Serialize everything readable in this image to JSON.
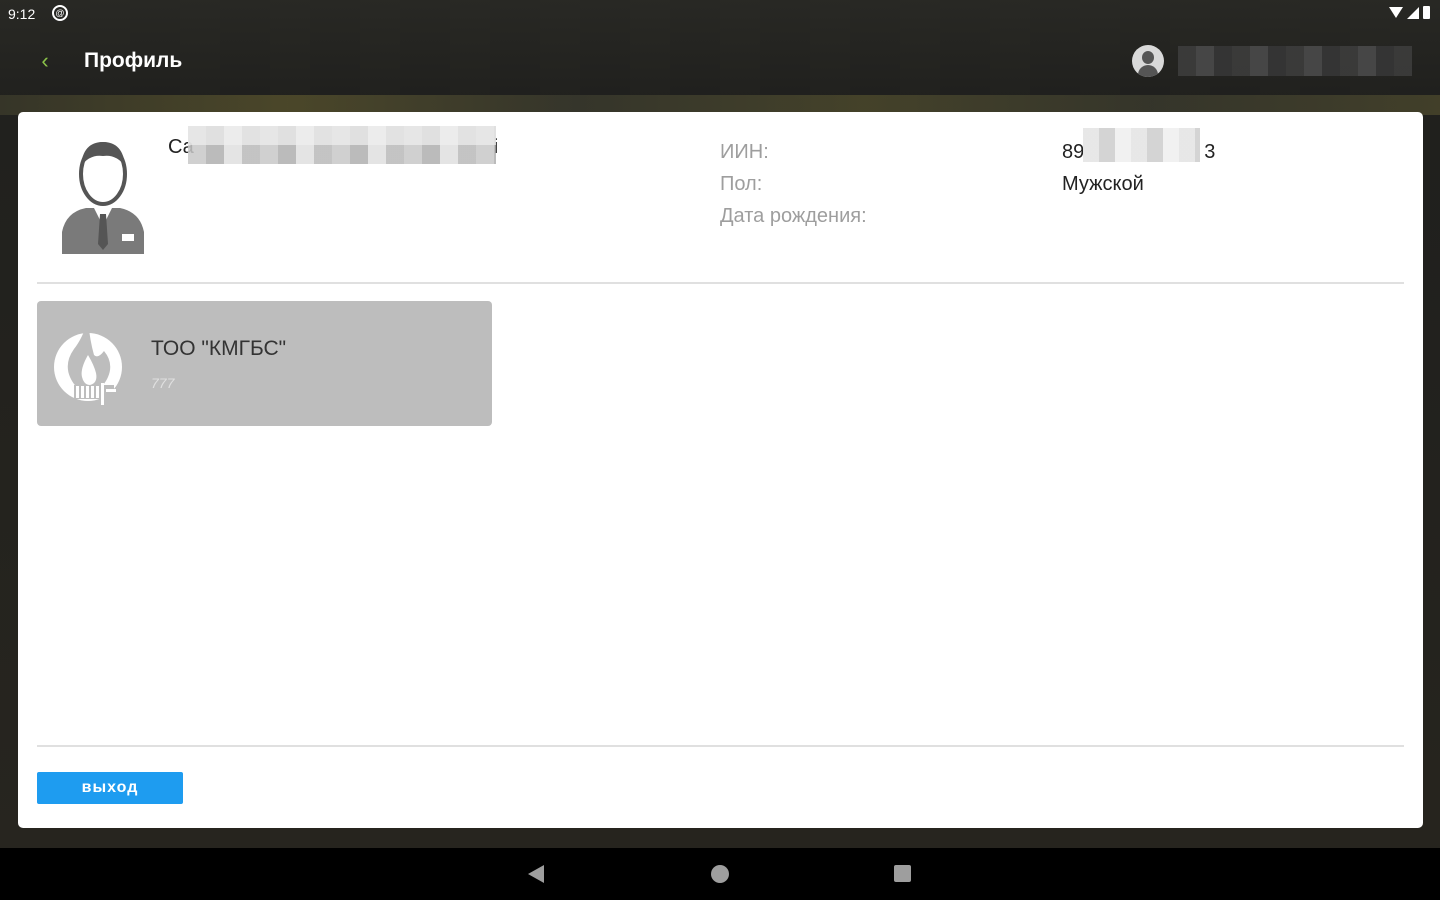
{
  "status_bar": {
    "time": "9:12",
    "notification_icon": "circle-at-icon",
    "system_icons": [
      "wifi-icon",
      "signal-icon",
      "battery-icon"
    ]
  },
  "toolbar": {
    "back_icon": "chevron-left-icon",
    "title": "Профиль",
    "account_icon": "account-avatar-icon",
    "accent_color": "#8bc34a"
  },
  "profile": {
    "name_visible_prefix": "Са",
    "name_visible_suffix": "і",
    "fields": {
      "iin_label": "ИИН:",
      "gender_label": "Пол:",
      "birthdate_label": "Дата рождения:",
      "iin_value_prefix": "89",
      "iin_value_suffix": "3",
      "gender_value": "Мужской",
      "birthdate_value": ""
    }
  },
  "organizations": [
    {
      "name": "ТОО \"КМГБС\"",
      "code": "777",
      "icon": "flame-drop-logo-icon"
    }
  ],
  "actions": {
    "logout_label": "выход",
    "logout_color": "#1e9cf0"
  },
  "nav_bar": {
    "icons": [
      "back-triangle-icon",
      "home-circle-icon",
      "recents-square-icon"
    ]
  }
}
